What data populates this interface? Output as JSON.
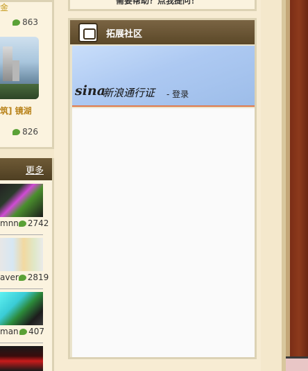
{
  "left_card": {
    "top_text": "金",
    "count_top": "863",
    "title": "筑] 镜湖",
    "count_bottom": "826"
  },
  "left_list": {
    "more_label": "更多",
    "items": [
      {
        "author": "mnn",
        "count": "2742"
      },
      {
        "author": "aver",
        "count": "2819"
      },
      {
        "author": "man",
        "count": "407"
      }
    ]
  },
  "top_banner": {
    "text": "需要帮助？点我提问！"
  },
  "panel": {
    "title": "拓展社区",
    "sina_logo": "sina",
    "sina_text": "新浪通行证",
    "login": "- 登录"
  },
  "colors": {
    "accent": "#5b4828",
    "cream": "#fbf3df",
    "link_orange": "#b88219",
    "comment_green": "#5aa136"
  }
}
